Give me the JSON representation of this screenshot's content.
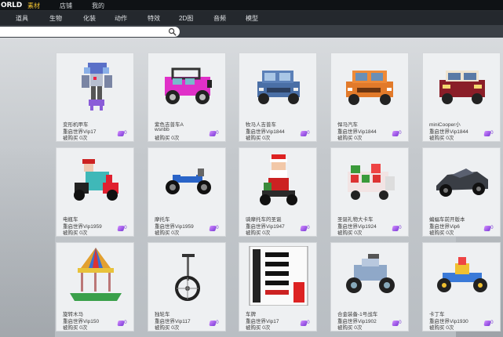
{
  "app": {
    "logo": "ORLD"
  },
  "top_tabs": [
    {
      "label": "素材",
      "active": true
    },
    {
      "label": "店铺",
      "active": false
    },
    {
      "label": "我的",
      "active": false
    }
  ],
  "categories": [
    "道具",
    "生物",
    "化装",
    "动作",
    "特效",
    "2D图",
    "音频",
    "模型"
  ],
  "search": {
    "value": "",
    "placeholder": ""
  },
  "colors": {
    "accent": "#f4c430",
    "price": "#7c3bd6"
  },
  "cards": [
    {
      "title": "变形机甲车",
      "author": "重启世界Vip17",
      "buys": "被购买 0次",
      "price": "0",
      "icon": "mech-robot-car"
    },
    {
      "title": "紫色吉普车A",
      "author": "wsnbb",
      "buys": "被购买 0次",
      "price": "0",
      "icon": "purple-jeep"
    },
    {
      "title": "牧马人吉普车",
      "author": "重启世界Vip1844",
      "buys": "被购买 0次",
      "price": "0",
      "icon": "blue-jeep"
    },
    {
      "title": "悍马汽车",
      "author": "重启世界Vip1844",
      "buys": "被购买 0次",
      "price": "0",
      "icon": "orange-hummer"
    },
    {
      "title": "miniCooper小",
      "author": "重启世界Vip1844",
      "buys": "被购买 0次",
      "price": "0",
      "icon": "red-mini-cooper"
    },
    {
      "title": "电瓶车",
      "author": "重启世界Vip1959",
      "buys": "被购买 0次",
      "price": "0",
      "icon": "electric-scooter"
    },
    {
      "title": "摩托车",
      "author": "重启世界Vip1959",
      "buys": "被购买 0次",
      "price": "0",
      "icon": "blue-motorcycle"
    },
    {
      "title": "骑摩托车的圣诞",
      "author": "重启世界Vip1947",
      "buys": "被购买 0次",
      "price": "0",
      "icon": "santa-motorcycle"
    },
    {
      "title": "圣诞礼物大卡车",
      "author": "重启世界Vip1924",
      "buys": "被购买 0次",
      "price": "0",
      "icon": "gift-truck"
    },
    {
      "title": "蝙蝠车前开版本",
      "author": "重启世界Vip6",
      "buys": "被购买 0次",
      "price": "0",
      "icon": "batmobile"
    },
    {
      "title": "旋转木马",
      "author": "重启世界Vip150",
      "buys": "被购买 0次",
      "price": "0",
      "icon": "carousel"
    },
    {
      "title": "独轮车",
      "author": "重启世界Vip117",
      "buys": "被购买 0次",
      "price": "0",
      "icon": "unicycle"
    },
    {
      "title": "车牌",
      "author": "重启世界Vip17",
      "buys": "被购买 0次",
      "price": "0",
      "icon": "license-plate"
    },
    {
      "title": "合金装备-1号战车",
      "author": "重启世界Vip1902",
      "buys": "被购买 0次",
      "price": "0",
      "icon": "armored-buggy"
    },
    {
      "title": "卡丁车",
      "author": "重启世界Vip1930",
      "buys": "被购买 0次",
      "price": "0",
      "icon": "go-kart"
    }
  ]
}
